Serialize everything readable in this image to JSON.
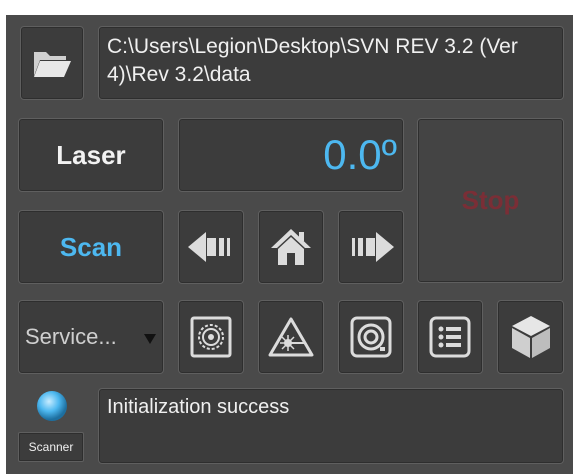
{
  "path": {
    "text": "C:\\Users\\Legion\\Desktop\\SVN REV 3.2 (Ver 4)\\Rev 3.2\\data"
  },
  "buttons": {
    "laser_label": "Laser",
    "scan_label": "Scan",
    "stop_label": "Stop"
  },
  "angle": {
    "value": "0.0º"
  },
  "service": {
    "selected": "Service..."
  },
  "status": {
    "message": "Initialization success",
    "scanner_label": "Scanner"
  },
  "icons": {
    "open_folder": "folder-open-icon",
    "prev": "arrow-left-icon",
    "home": "home-icon",
    "next": "arrow-right-icon",
    "target": "target-icon",
    "laser_warning": "laser-warning-icon",
    "camera": "camera-icon",
    "list": "list-icon",
    "cube": "cube-icon",
    "indicator": "status-led-icon"
  },
  "colors": {
    "accent_blue": "#4db8f0",
    "stop_red": "#7a2e36",
    "panel_bg": "#4a4a4a",
    "button_bg": "#3c3c3c"
  }
}
